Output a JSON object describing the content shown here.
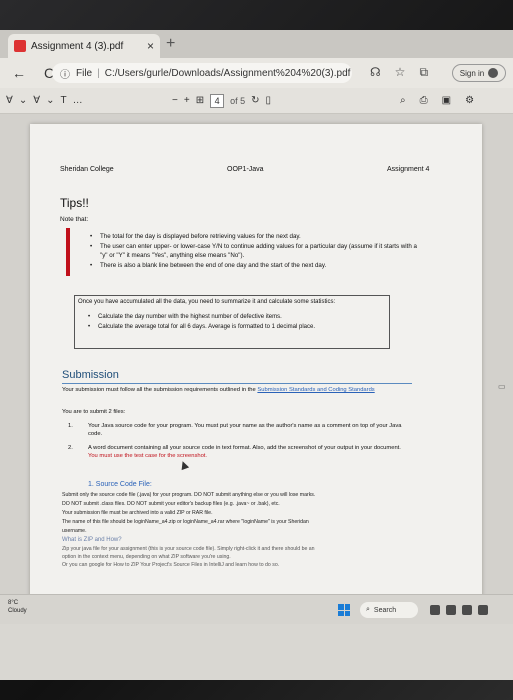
{
  "browser": {
    "tab_title": "Assignment 4 (3).pdf",
    "tab_close": "×",
    "new_tab": "+",
    "back": "←",
    "refresh": "C",
    "address_scheme": "File",
    "address_path": "C:/Users/gurle/Downloads/Assignment%204%20(3).pdf",
    "sign_in": "Sign in"
  },
  "pdf_toolbar": {
    "zoom_out": "−",
    "zoom_in": "+",
    "current_page": "4",
    "of_pages": "of 5"
  },
  "document": {
    "header_left": "Sheridan College",
    "header_center": "OOP1-Java",
    "header_right": "Assignment 4",
    "tips_title": "Tips!!",
    "note_label": "Note that:",
    "tips": [
      "The total for the day is displayed before retrieving values for the next day.",
      "The user can enter upper- or lower-case Y/N to continue adding values for a particular day (assume if it starts with a \"y\" or \"Y\" it means \"Yes\", anything else means \"No\").",
      "There is also a blank line between the end of one day and the start of the next day."
    ],
    "summary_intro": "Once you have accumulated all the data, you need to summarize it and calculate some statistics:",
    "summary_items": [
      "Calculate the day number with the highest number of defective items.",
      "Calculate the average total for all 6 days. Average is formatted to 1 decimal place."
    ],
    "submission_heading": "Submission",
    "submission_text_1": "Your submission must follow all the submission requirements outlined in the",
    "submission_link": "Submission Standards and Coding Standards",
    "submit_intro": "You are to submit 2 files:",
    "item1_num": "1.",
    "item1_text": "Your Java source code for your program. You must put your name as the author's name as a comment on top of your Java code.",
    "item2_num": "2.",
    "item2_text": "A word document containing all your source code in text format. Also, add the screenshot of your output in your document.",
    "item2_red": "You must use the test case for the screenshot.",
    "src_title": "1. Source Code File:",
    "src_lines": [
      "Submit only the source code file (.java) for your program. DO NOT submit anything else or you will lose marks.",
      "DO NOT submit .class files. DO NOT submit your editor's backup files (e.g. .java~ or .bak), etc.",
      "Your submission file must be archived into a valid ZIP or RAR file.",
      "The name of this file should be loginName_a4.zip or loginName_a4.rar where \"loginName\" is your Sheridan",
      "username."
    ],
    "zip_title": "What is ZIP and How?",
    "zip_lines": [
      "Zip your java file for your assignment (this is your source code file). Simply right-click it and there should be an",
      "option in the context menu, depending on what ZIP software you're using.",
      "Or you can google for How to ZIP Your Project's Source Files in IntelliJ and learn how to do so."
    ]
  },
  "taskbar": {
    "weather_temp": "8°C",
    "weather_desc": "Cloudy",
    "search_label": "Search"
  }
}
